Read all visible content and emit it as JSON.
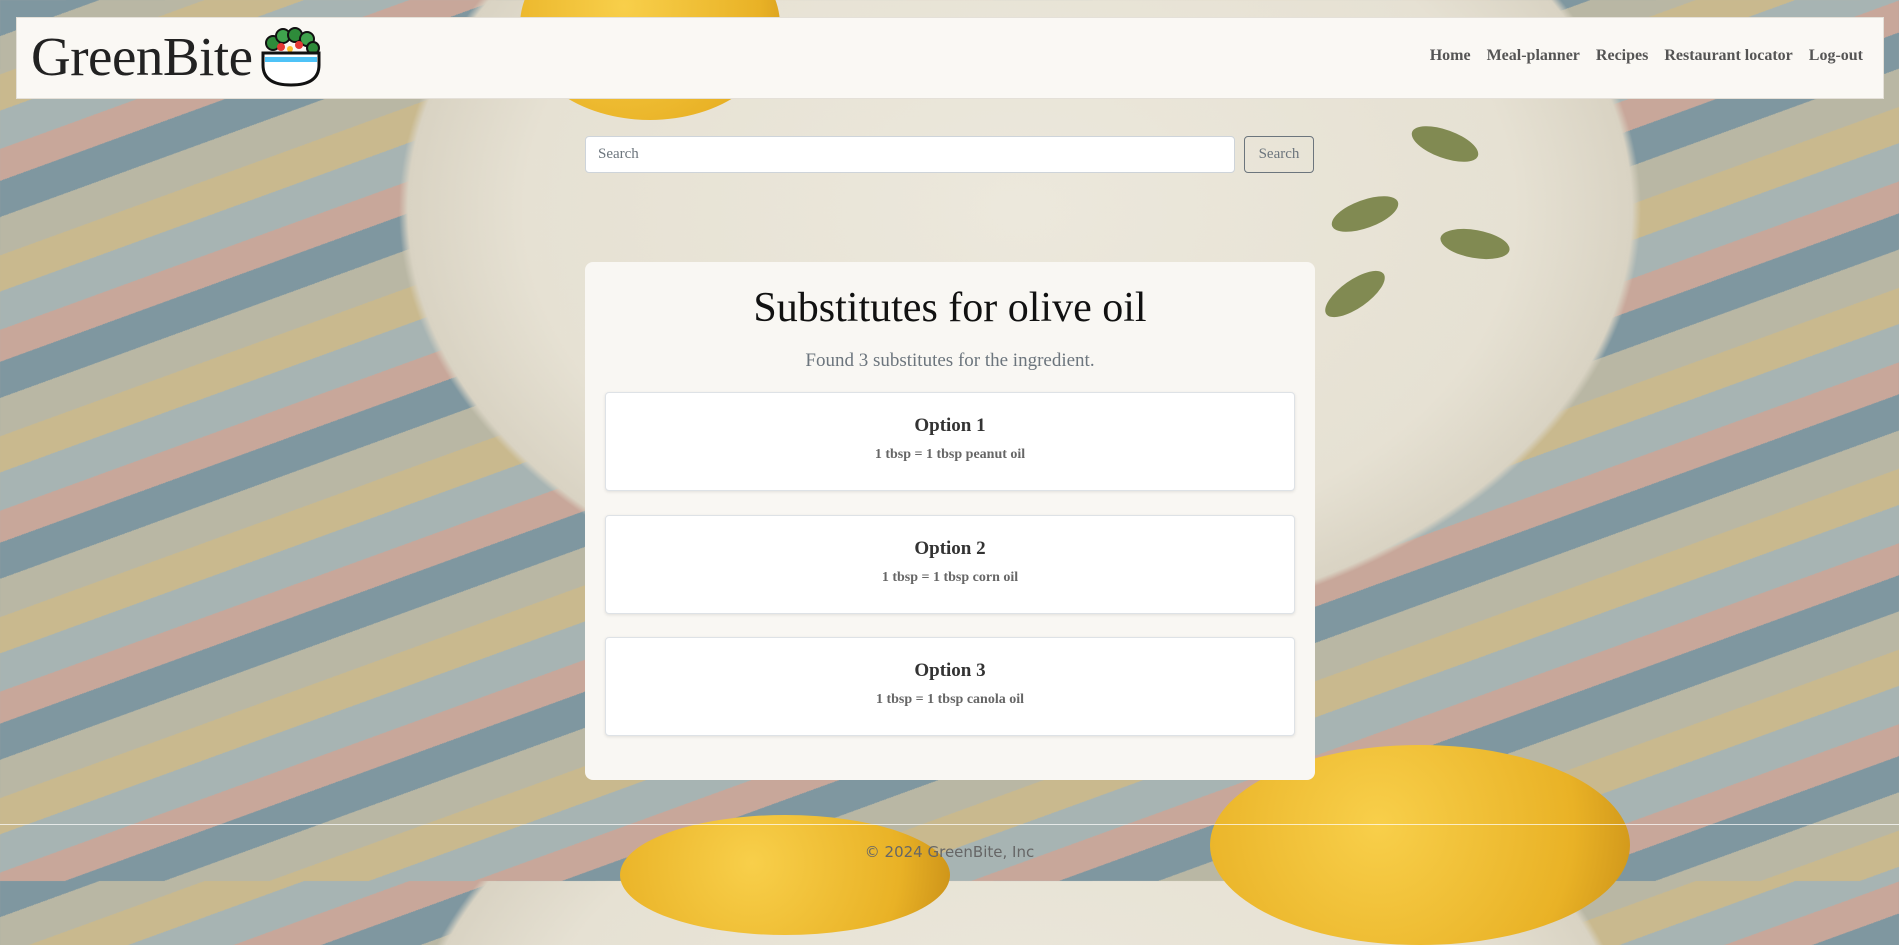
{
  "header": {
    "brand": "GreenBite",
    "nav": [
      {
        "label": "Home"
      },
      {
        "label": "Meal-planner"
      },
      {
        "label": "Recipes"
      },
      {
        "label": "Restaurant locator"
      },
      {
        "label": "Log-out"
      }
    ]
  },
  "search": {
    "placeholder": "Search",
    "button_label": "Search"
  },
  "main": {
    "title": "Substitutes for olive oil",
    "subtitle": "Found 3 substitutes for the ingredient.",
    "options": [
      {
        "title": "Option 1",
        "description": "1 tbsp = 1 tbsp peanut oil"
      },
      {
        "title": "Option 2",
        "description": "1 tbsp = 1 tbsp corn oil"
      },
      {
        "title": "Option 3",
        "description": "1 tbsp = 1 tbsp canola oil"
      }
    ]
  },
  "footer": {
    "copyright": "© 2024 GreenBite, Inc"
  }
}
